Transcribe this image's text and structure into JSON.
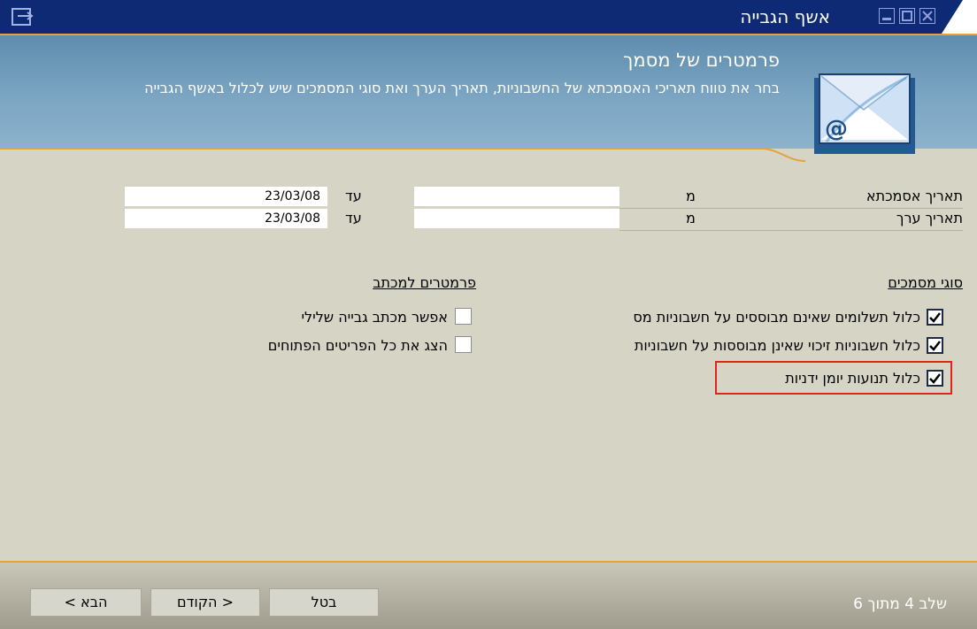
{
  "window": {
    "title": "אשף הגבייה"
  },
  "header": {
    "title": "פרמטרים של מסמך",
    "description": "בחר את טווח תאריכי האסמכתא של החשבוניות, תאריך הערך ואת סוגי המסמכים שיש לכלול באשף הגבייה"
  },
  "dates": {
    "ref_date": {
      "label": "תאריך אסמכתא",
      "from_label": "מ",
      "from_value": "",
      "to_label": "עד",
      "to_value": "23/03/08"
    },
    "value_date": {
      "label": "תאריך ערך",
      "from_label": "מ",
      "from_value": "",
      "to_label": "עד",
      "to_value": "23/03/08"
    }
  },
  "doc_types": {
    "heading": "סוגי מסמכים",
    "options": [
      {
        "label": "כלול תשלומים שאינם מבוססים על חשבוניות מס",
        "checked": true
      },
      {
        "label": "כלול חשבוניות  זיכוי שאינן מבוססות על חשבוניות",
        "checked": true
      },
      {
        "label": "כלול תנועות יומן ידניות",
        "checked": true
      }
    ]
  },
  "letter_params": {
    "heading": "פרמטרים למכתב",
    "options": [
      {
        "label": "אפשר מכתב גבייה שלילי",
        "checked": false
      },
      {
        "label": "הצג את כל הפריטים הפתוחים",
        "checked": false
      }
    ]
  },
  "footer": {
    "step_text": "שלב 4 מתוך 6",
    "cancel_label": "בטל",
    "back_label": "< הקודם",
    "next_label": "הבא >"
  },
  "colors": {
    "title_bar": "#0f2a74",
    "accent": "#e7a23a",
    "header_bg": "#7ba5c2",
    "highlight": "#e0231b"
  }
}
